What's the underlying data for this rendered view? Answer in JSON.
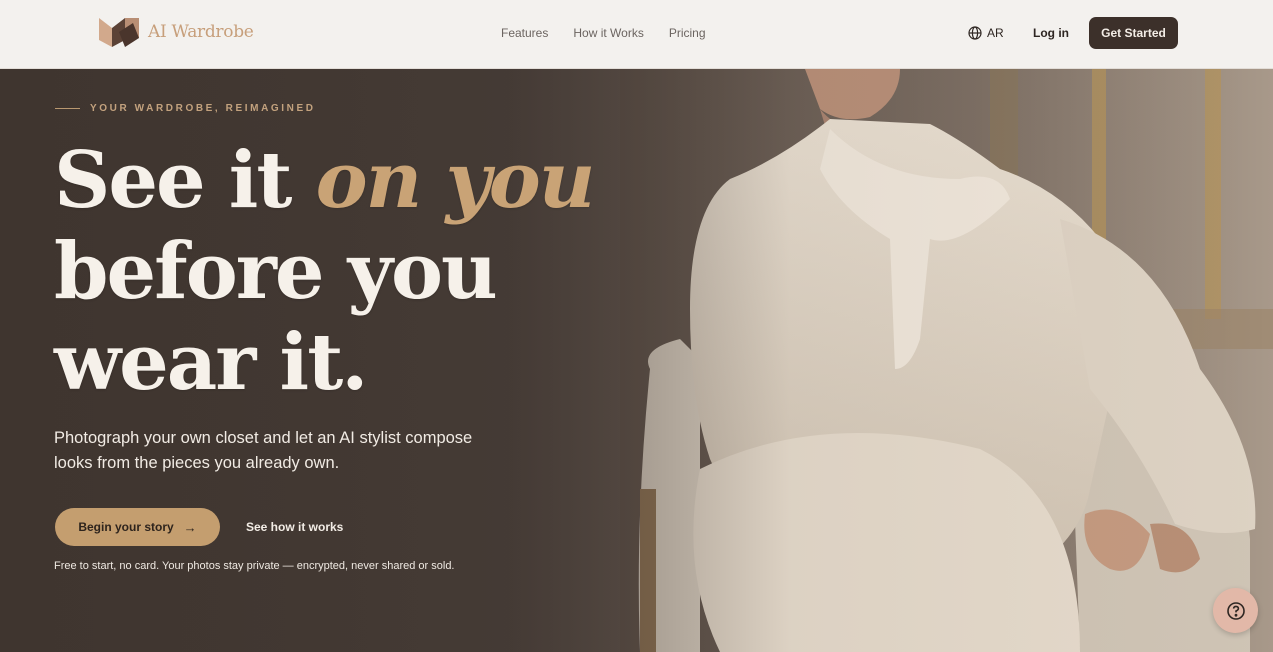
{
  "brand": {
    "name": "AI Wardrobe",
    "logo_icon": "folded-ribbon-logo"
  },
  "nav": {
    "items": [
      "Features",
      "How it Works",
      "Pricing"
    ]
  },
  "header": {
    "language": "AR",
    "language_icon": "globe-icon",
    "login": "Log in",
    "cta": "Get Started"
  },
  "hero": {
    "eyebrow": "YOUR WARDROBE, REIMAGINED",
    "headline": {
      "part1": "See it ",
      "accent": "on you",
      "line2": "before you",
      "line3": "wear it."
    },
    "subtitle": "Photograph your own closet and let an AI stylist compose looks from the pieces you already own.",
    "primary_cta": "Begin your story",
    "primary_cta_icon": "arrow-right-icon",
    "secondary_cta": "See how it works",
    "fineprint": "Free to start, no card. Your photos stay private — encrypted, never shared or sold."
  },
  "help": {
    "icon": "question-circle-icon"
  },
  "colors": {
    "accent_gold": "#c49e6f",
    "dark_brown": "#3c302a",
    "header_bg": "#f3f1ee",
    "help_button": "#e2b8a8"
  }
}
